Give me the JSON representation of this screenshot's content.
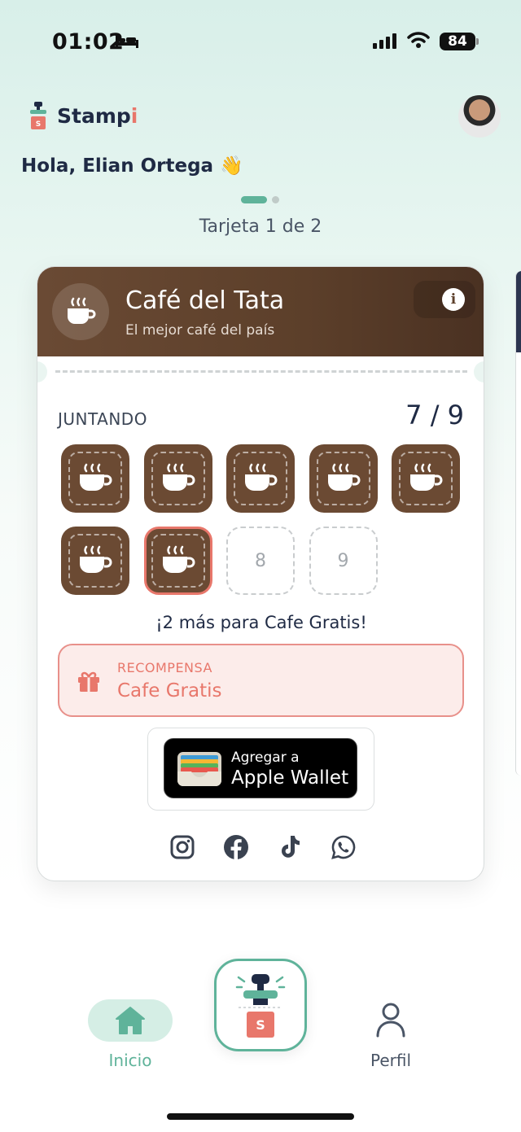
{
  "status_bar": {
    "time": "01:02",
    "battery": "84"
  },
  "header": {
    "logo_text_main": "Stamp",
    "logo_text_accent": "i",
    "greeting": "Hola, Elian Ortega 👋"
  },
  "pager": {
    "label": "Tarjeta 1 de 2"
  },
  "card": {
    "shop_name": "Café del Tata",
    "tagline": "El mejor café del país",
    "info_label": "i",
    "collect_label": "JUNTANDO",
    "count": "7 / 9",
    "stamps": [
      {
        "filled": true
      },
      {
        "filled": true
      },
      {
        "filled": true
      },
      {
        "filled": true
      },
      {
        "filled": true
      },
      {
        "filled": true
      },
      {
        "filled": true,
        "latest": true
      },
      {
        "filled": false,
        "number": "8"
      },
      {
        "filled": false,
        "number": "9"
      }
    ],
    "remaining": "¡2 más para Cafe Gratis!",
    "reward": {
      "label": "RECOMPENSA",
      "value": "Cafe Gratis"
    },
    "wallet": {
      "small": "Agregar a",
      "big": "Apple Wallet"
    },
    "socials": [
      "instagram-icon",
      "facebook-icon",
      "tiktok-icon",
      "whatsapp-icon"
    ]
  },
  "tabbar": {
    "home": "Inicio",
    "profile": "Perfil"
  },
  "colors": {
    "accent": "#5fb39a",
    "coffee": "#6b4a33",
    "reward": "#e8776b",
    "navy": "#1f2a44"
  }
}
